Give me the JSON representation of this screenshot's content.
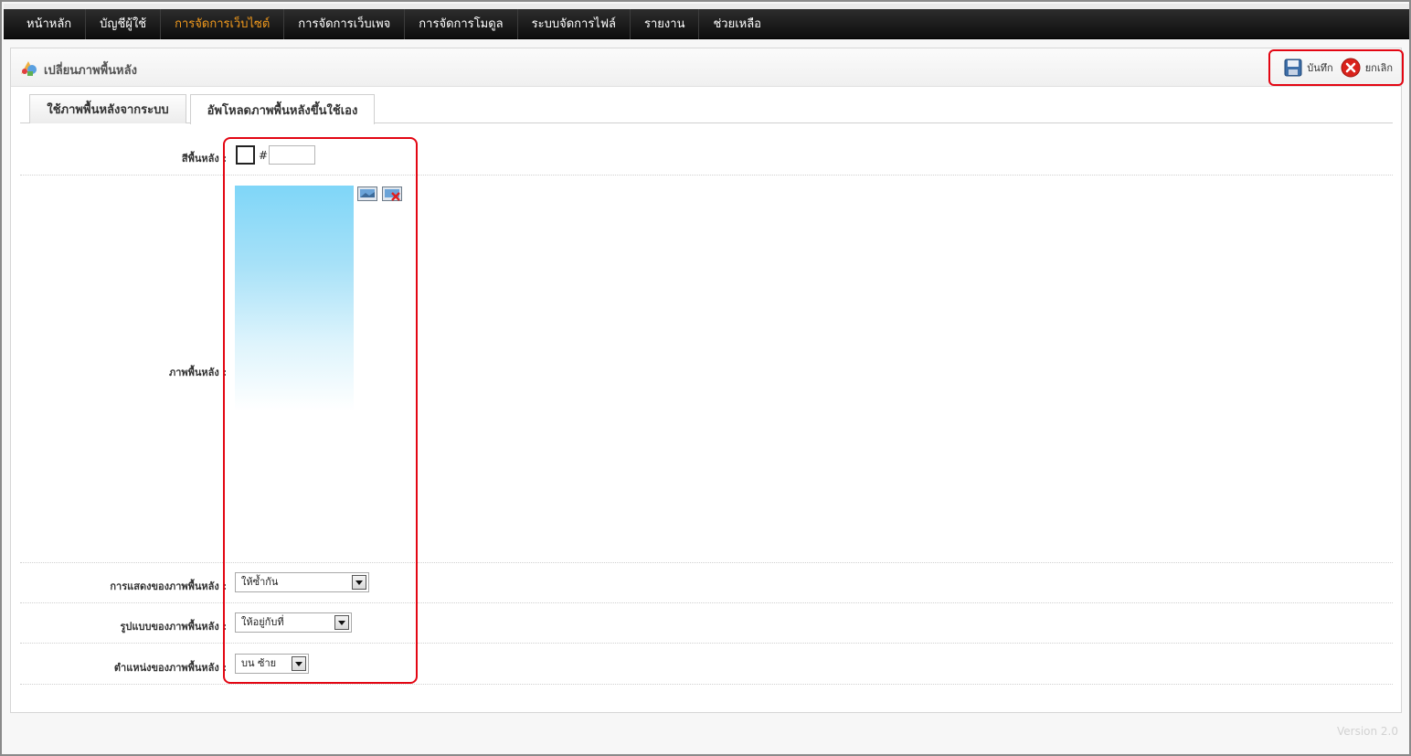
{
  "nav": {
    "items": [
      {
        "label": "หน้าหลัก",
        "active": false
      },
      {
        "label": "บัญชีผู้ใช้",
        "active": false
      },
      {
        "label": "การจัดการเว็บไซต์",
        "active": true
      },
      {
        "label": "การจัดการเว็บเพจ",
        "active": false
      },
      {
        "label": "การจัดการโมดูล",
        "active": false
      },
      {
        "label": "ระบบจัดการไฟล์",
        "active": false
      },
      {
        "label": "รายงาน",
        "active": false
      },
      {
        "label": "ช่วยเหลือ",
        "active": false
      }
    ],
    "active_color": "#f29a1c"
  },
  "panel": {
    "title": "เปลี่ยนภาพพื้นหลัง",
    "save_label": "บันทึก",
    "cancel_label": "ยกเลิก"
  },
  "tabs": [
    {
      "label": "ใช้ภาพพื้นหลังจากระบบ",
      "active": false
    },
    {
      "label": "อัพโหลดภาพพื้นหลังขึ้นใช้เอง",
      "active": true
    }
  ],
  "form": {
    "bg_color_label": "สีพื้นหลัง :",
    "hash": "#",
    "bg_color_value": "",
    "bg_image_label": "ภาพพื้นหลัง :",
    "repeat_label": "การแสดงของภาพพื้นหลัง :",
    "repeat_value": "ให้ซ้ำกัน",
    "attachment_label": "รูปแบบของภาพพื้นหลัง :",
    "attachment_value": "ให้อยู่กับที่",
    "position_label": "ตำแหน่งของภาพพื้นหลัง :",
    "position_value": "บน ซ้าย"
  },
  "footer": {
    "version": "Version 2.0"
  },
  "icons": {
    "title": "themes-icon",
    "save": "floppy-disk-icon",
    "cancel": "red-x-circle-icon",
    "browse": "image-browse-icon",
    "remove": "image-remove-icon"
  },
  "colors": {
    "highlight": "#e30613",
    "nav_bg": "#1a1a1a"
  }
}
